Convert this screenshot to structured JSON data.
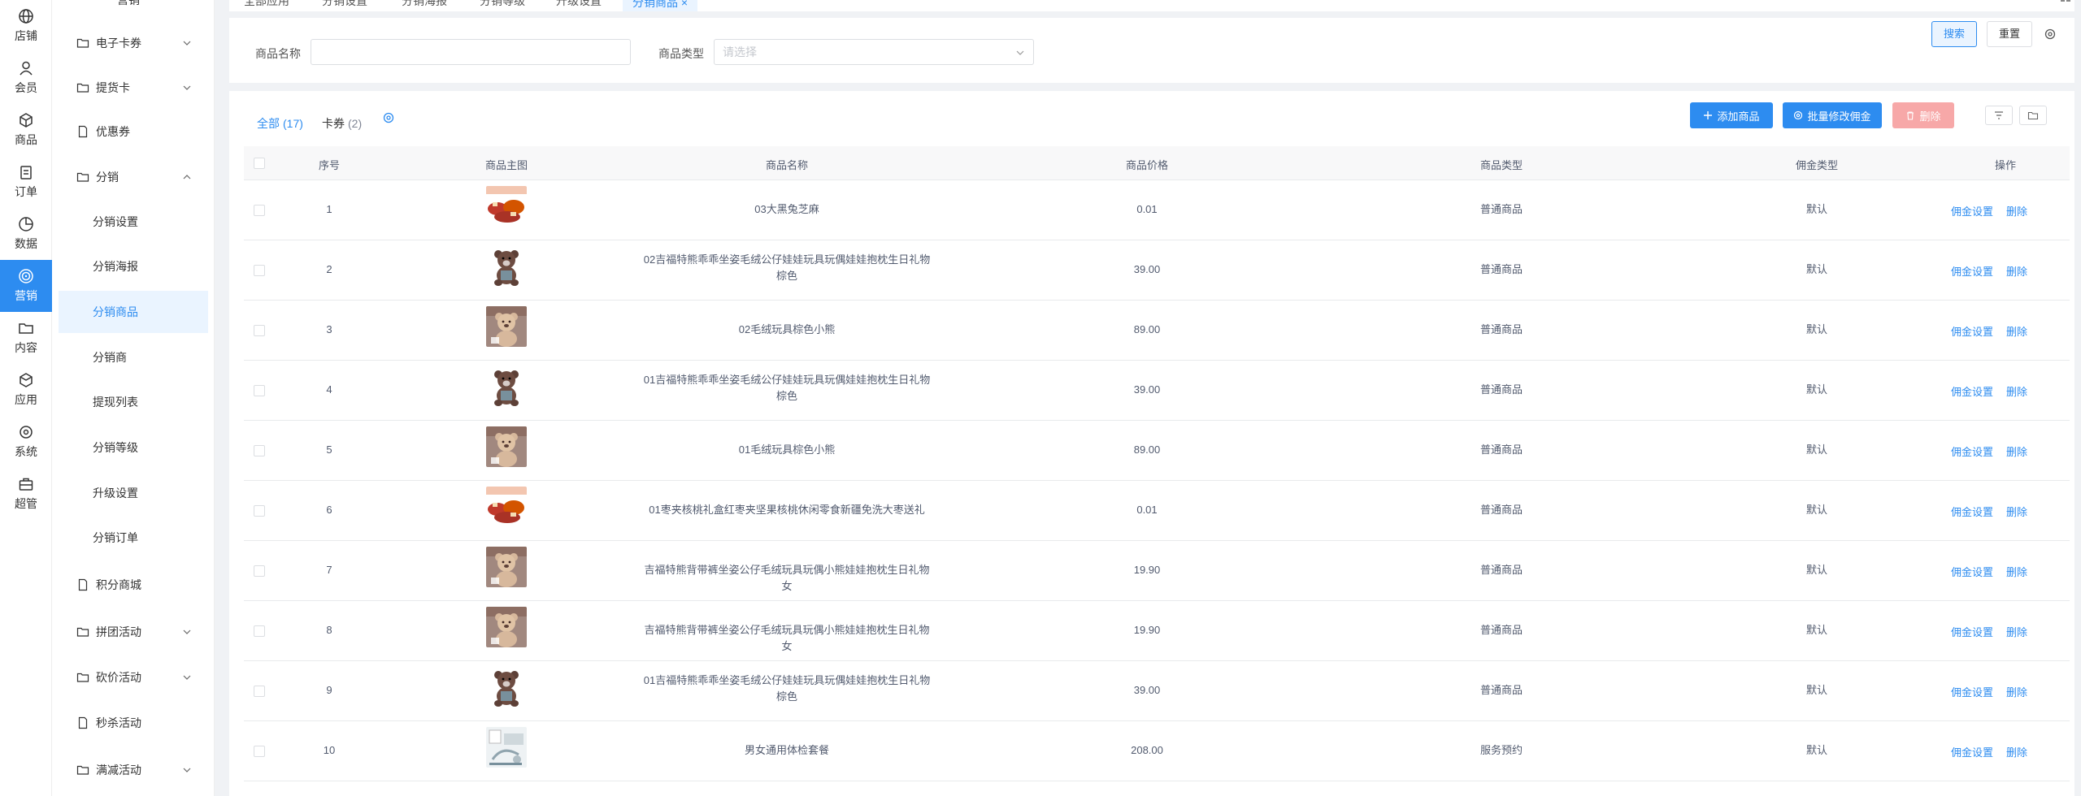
{
  "rail": [
    {
      "label": "店铺",
      "icon": "globe-icon"
    },
    {
      "label": "会员",
      "icon": "user-icon"
    },
    {
      "label": "商品",
      "icon": "cube-icon"
    },
    {
      "label": "订单",
      "icon": "clipboard-icon"
    },
    {
      "label": "数据",
      "icon": "pie-chart-icon"
    },
    {
      "label": "营销",
      "icon": "target-icon"
    },
    {
      "label": "内容",
      "icon": "folder-icon"
    },
    {
      "label": "应用",
      "icon": "box-icon"
    },
    {
      "label": "系统",
      "icon": "gear-icon"
    },
    {
      "label": "超管",
      "icon": "briefcase-icon"
    }
  ],
  "submenu": {
    "top_label": "营销",
    "items": [
      {
        "label": "电子卡券",
        "type": "folder",
        "chevron": "down"
      },
      {
        "label": "提货卡",
        "type": "folder",
        "chevron": "down"
      },
      {
        "label": "优惠券",
        "type": "file"
      },
      {
        "label": "分销",
        "type": "folder",
        "chevron": "up"
      },
      {
        "label": "分销设置",
        "type": "sub"
      },
      {
        "label": "分销海报",
        "type": "sub"
      },
      {
        "label": "分销商品",
        "type": "sub",
        "active": true
      },
      {
        "label": "分销商",
        "type": "sub"
      },
      {
        "label": "提现列表",
        "type": "sub"
      },
      {
        "label": "分销等级",
        "type": "sub"
      },
      {
        "label": "升级设置",
        "type": "sub"
      },
      {
        "label": "分销订单",
        "type": "sub"
      },
      {
        "label": "积分商城",
        "type": "file"
      },
      {
        "label": "拼团活动",
        "type": "folder",
        "chevron": "down"
      },
      {
        "label": "砍价活动",
        "type": "folder",
        "chevron": "down"
      },
      {
        "label": "秒杀活动",
        "type": "file"
      },
      {
        "label": "满减活动",
        "type": "folder",
        "chevron": "down"
      }
    ]
  },
  "top_tabs": [
    "全部应用",
    "分销设置",
    "分销海报",
    "分销等级",
    "升级设置",
    "分销商品 ×"
  ],
  "search": {
    "name_label": "商品名称",
    "name_value": "",
    "type_label": "商品类型",
    "type_placeholder": "请选择",
    "search_button": "搜索",
    "reset_button": "重置"
  },
  "tabs": [
    {
      "label": "全部",
      "count": "(17)"
    },
    {
      "label": "卡券",
      "count": "(2)"
    }
  ],
  "actions": {
    "add": "添加商品",
    "batch": "批量修改佣金",
    "delete": "删除"
  },
  "table": {
    "headers": [
      "序号",
      "商品主图",
      "商品名称",
      "商品价格",
      "商品类型",
      "佣金类型",
      "操作"
    ],
    "op_settings": "佣金设置",
    "op_delete": "删除",
    "rows": [
      {
        "no": "1",
        "name": [
          "03大黑兔芝麻"
        ],
        "price": "0.01",
        "type": "普通商品",
        "commission": "默认",
        "thumb": "gift"
      },
      {
        "no": "2",
        "name": [
          "02吉福特熊乖乖坐姿毛绒公仔娃娃玩具玩偶娃娃抱枕生日礼物",
          "棕色"
        ],
        "price": "39.00",
        "type": "普通商品",
        "commission": "默认",
        "thumb": "bear"
      },
      {
        "no": "3",
        "name": [
          "02毛绒玩具棕色小熊"
        ],
        "price": "89.00",
        "type": "普通商品",
        "commission": "默认",
        "thumb": "bear-brown"
      },
      {
        "no": "4",
        "name": [
          "01吉福特熊乖乖坐姿毛绒公仔娃娃玩具玩偶娃娃抱枕生日礼物",
          "棕色"
        ],
        "price": "39.00",
        "type": "普通商品",
        "commission": "默认",
        "thumb": "bear"
      },
      {
        "no": "5",
        "name": [
          "01毛绒玩具棕色小熊"
        ],
        "price": "89.00",
        "type": "普通商品",
        "commission": "默认",
        "thumb": "bear-brown"
      },
      {
        "no": "6",
        "name": [
          "01枣夹核桃礼盒红枣夹坚果核桃休闲零食新疆免洗大枣送礼"
        ],
        "price": "0.01",
        "type": "普通商品",
        "commission": "默认",
        "thumb": "gift"
      },
      {
        "no": "7",
        "name": [
          "吉福特熊背带裤坐姿公仔毛绒玩具玩偶小熊娃娃抱枕生日礼物女"
        ],
        "price": "19.90",
        "type": "普通商品",
        "commission": "默认",
        "thumb": "bear-brown"
      },
      {
        "no": "8",
        "name": [
          "吉福特熊背带裤坐姿公仔毛绒玩具玩偶小熊娃娃抱枕生日礼物女"
        ],
        "price": "19.90",
        "type": "普通商品",
        "commission": "默认",
        "thumb": "bear-brown"
      },
      {
        "no": "9",
        "name": [
          "01吉福特熊乖乖坐姿毛绒公仔娃娃玩具玩偶娃娃抱枕生日礼物",
          "棕色"
        ],
        "price": "39.00",
        "type": "普通商品",
        "commission": "默认",
        "thumb": "bear"
      },
      {
        "no": "10",
        "name": [
          "男女通用体检套餐"
        ],
        "price": "208.00",
        "type": "服务预约",
        "commission": "默认",
        "thumb": "checkup"
      }
    ]
  },
  "colors": {
    "primary": "#2d8cf0",
    "danger_disabled": "#f7a8a8",
    "active_bg": "#eaf4ff"
  }
}
